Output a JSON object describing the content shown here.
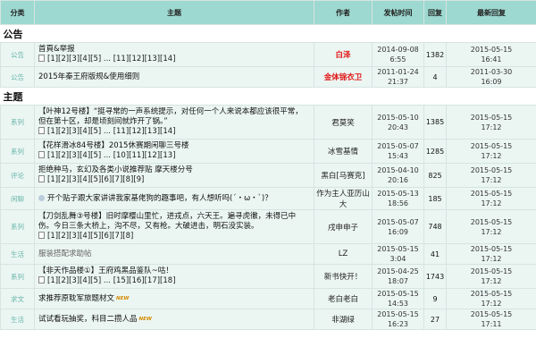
{
  "header": {
    "cat": "分类",
    "title": "主题",
    "author": "作者",
    "time": "发帖时间",
    "reply": "回复",
    "last": "最新回复"
  },
  "sections": {
    "notice": "公告",
    "topics": "主题"
  },
  "notices": [
    {
      "cat": "公告",
      "title": "首頁&举报",
      "pages": "[1][2][3][4][5] ... [11][12][13][14]",
      "author": "白泽",
      "author_red": true,
      "time_date": "2014-09-08",
      "time_clock": "6:55",
      "reply": "1382",
      "last_date": "2015-05-15",
      "last_clock": "16:41"
    },
    {
      "cat": "公告",
      "title": "2015年秦王府版规&使用细则",
      "pages": "",
      "author": "金体锦衣卫",
      "author_red": true,
      "time_date": "2011-01-24",
      "time_clock": "21:37",
      "reply": "4",
      "last_date": "2011-03-30",
      "last_clock": "16:09"
    }
  ],
  "topics": [
    {
      "cat": "系列",
      "title": "【叶神12号楼】“挺寻常的一声系统提示，对任何一个人来说本都应该很平常，但在第十区，却是顷刻间就炸开了锅。”",
      "pages": "[1][2][3][4][5] ... [11][12][13][14]",
      "author": "君莫笑",
      "time_date": "2015-05-10",
      "time_clock": "20:43",
      "reply": "1385",
      "last_date": "2015-05-15",
      "last_clock": "17:12"
    },
    {
      "cat": "系列",
      "title": "【花样滑冰84号楼】2015休赛期闲聊三号楼",
      "pages": "[1][2][3][4][5] ... [10][11][12][13]",
      "author": "冰雪基情",
      "time_date": "2015-05-07",
      "time_clock": "15:43",
      "reply": "1285",
      "last_date": "2015-05-15",
      "last_clock": "17:12"
    },
    {
      "cat": "评论",
      "title": "拒绝种马，玄幻及各类小说推荐贴 摩天楼分号",
      "pages": "[1][2][3][4][5][6][7][8][9]",
      "author": "黑白[马赛克]",
      "time_date": "2015-04-10",
      "time_clock": "20:16",
      "reply": "825",
      "last_date": "2015-05-15",
      "last_clock": "17:12"
    },
    {
      "cat": "闲聊",
      "title": "开个贴子跟大家讲讲我家基佬狗的趣事吧，有人想听吗(´・ω・`)？",
      "pages": "",
      "author": "作为主人亚历山大",
      "time_date": "2015-05-13",
      "time_clock": "18:56",
      "reply": "185",
      "last_date": "2015-05-15",
      "last_clock": "17:12",
      "face": true
    },
    {
      "cat": "系列",
      "title": "【刀剑乱舞③号楼】旧时摩樱山里忙，进戎点，六天王。遍寻虎徹，未得已中伤。今日三条大桥上，沟不尽，又有枪。大破进击，明石没实装。",
      "pages": "[1][2][3][4][5][6][7][8]",
      "author": "戌申申子",
      "time_date": "2015-05-07",
      "time_clock": "16:09",
      "reply": "748",
      "last_date": "2015-05-15",
      "last_clock": "17:12"
    },
    {
      "cat": "生活",
      "title": "服装搭配求助帖",
      "pages": "",
      "author": "LZ",
      "time_date": "2015-05-15",
      "time_clock": "3:04",
      "reply": "41",
      "last_date": "2015-05-15",
      "last_clock": "17:12",
      "gray": true
    },
    {
      "cat": "系列",
      "title": "【非天作品楼①】王府鸡黑品鉴队~咕！",
      "pages": "[1][2][3][4][5] ... [15][16][17][18]",
      "author": "新书快开！",
      "time_date": "2015-04-25",
      "time_clock": "18:07",
      "reply": "1743",
      "last_date": "2015-05-15",
      "last_clock": "17:12"
    },
    {
      "cat": "求文",
      "title": "求推荐原耽军旅题材文",
      "pages": "",
      "author": "老白老白",
      "time_date": "2015-05-15",
      "time_clock": "14:53",
      "reply": "9",
      "last_date": "2015-05-15",
      "last_clock": "17:12",
      "new": true
    },
    {
      "cat": "生活",
      "title": "试试看玩抽奖，科目二攒人品",
      "pages": "",
      "author": "非湖绿",
      "time_date": "2015-05-15",
      "time_clock": "16:23",
      "reply": "27",
      "last_date": "2015-05-15",
      "last_clock": "17:11",
      "new": true
    }
  ],
  "badges": {
    "new": "NEW"
  }
}
